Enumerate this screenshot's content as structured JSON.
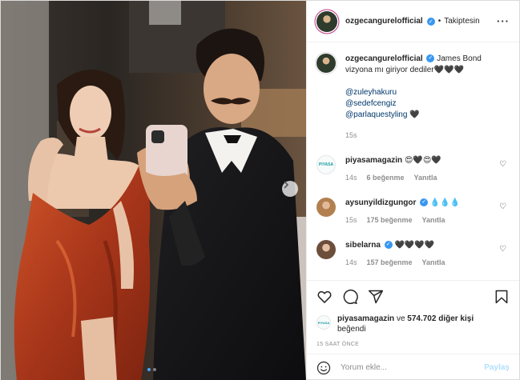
{
  "post": {
    "author": "ozgecangurelofficial",
    "follow_separator": "•",
    "follow_status": "Takiptesin",
    "more_icon": "more-horizontal-icon"
  },
  "caption": {
    "username": "ozgecangurelofficial",
    "text": "James Bond vizyona mı giriyor dediler🖤🖤🖤",
    "mentions": [
      "@zuleyhakuru",
      "@sedefcengiz",
      "@parlaquestyling"
    ],
    "trailing": "🖤",
    "time": "15s"
  },
  "comments": [
    {
      "username": "piyasamagazin",
      "verified": false,
      "text": "😍🖤😍🖤",
      "time": "14s",
      "likes": "6 beğenme",
      "reply": "Yanıtla",
      "avatar_text": "PIYASA"
    },
    {
      "username": "aysunyildizgungor",
      "verified": true,
      "text": "💧💧💧",
      "time": "15s",
      "likes": "175 beğenme",
      "reply": "Yanıtla"
    },
    {
      "username": "sibelarna",
      "verified": true,
      "text": "🖤🖤🖤🖤",
      "time": "14s",
      "likes": "157 beğenme",
      "reply": "Yanıtla"
    }
  ],
  "likes": {
    "avatar_text": "PIYASA",
    "first_user": "piyasamagazin",
    "connector": "ve",
    "count": "574.702 diğer kişi",
    "suffix": "beğendi"
  },
  "timestamp": "15 SAAT ÖNCE",
  "composer": {
    "placeholder": "Yorum ekle...",
    "post_label": "Paylaş"
  },
  "carousel": {
    "slides": 2,
    "active": 1
  },
  "colors": {
    "verified": "#3897f0",
    "link": "#00376b",
    "muted": "#8e8e8e",
    "post_disabled": "#b2dffc"
  }
}
